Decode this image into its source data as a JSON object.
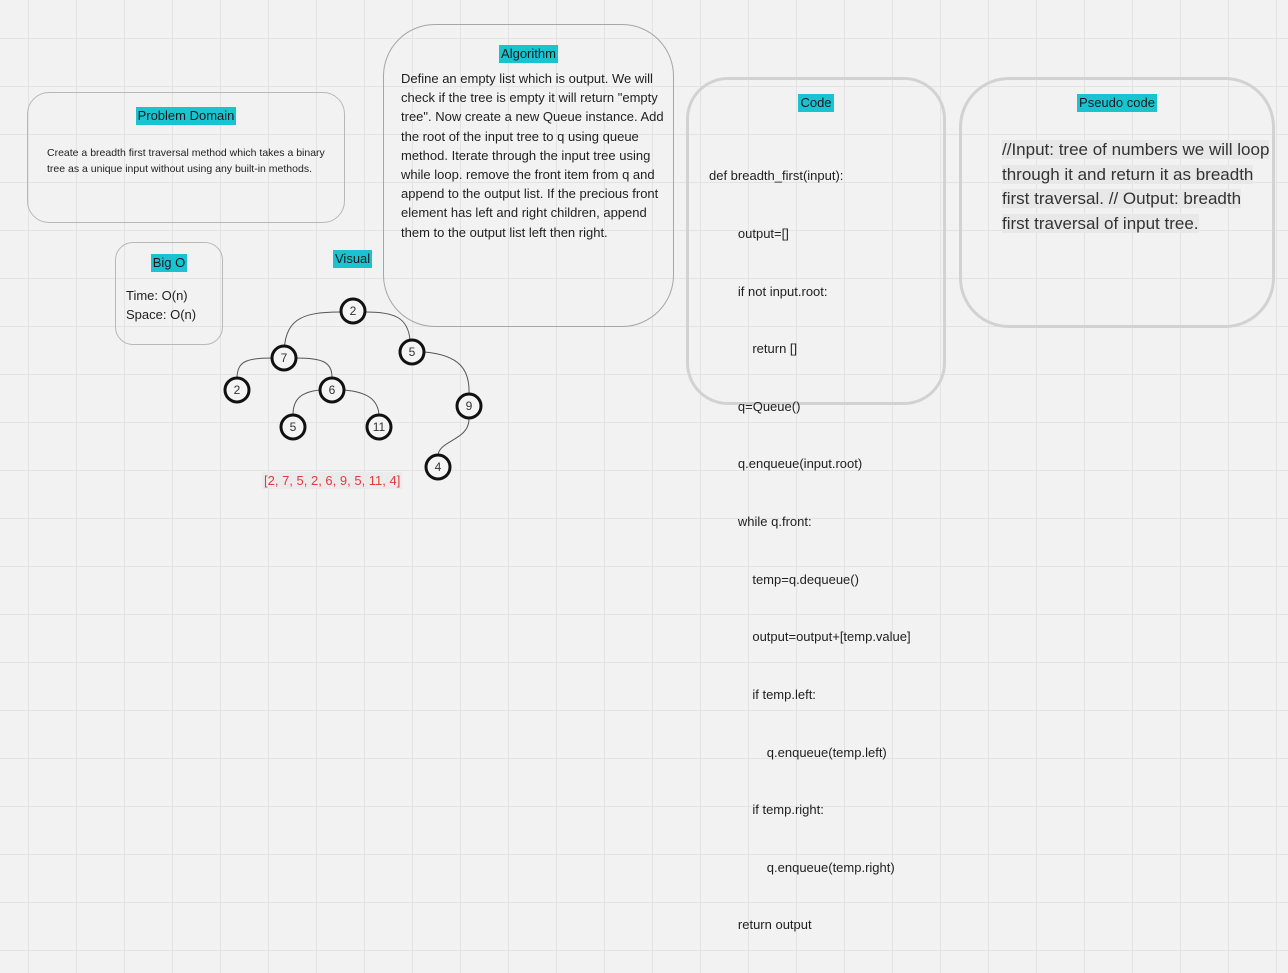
{
  "problem": {
    "title": "Problem Domain",
    "text": "Create a breadth first traversal method which takes a binary tree as a unique input without using any built-in methods."
  },
  "bigo": {
    "title": "Big O",
    "time": "Time: O(n)",
    "space": "Space: O(n)"
  },
  "visual": {
    "title": "Visual",
    "nodes": [
      "2",
      "7",
      "5",
      "2",
      "6",
      "9",
      "5",
      "11",
      "4"
    ],
    "traversal": "[2, 7, 5, 2, 6, 9, 5, 11, 4]"
  },
  "algorithm": {
    "title": "Algorithm",
    "text": "Define an empty list which is output. We will check if the tree is empty it will return \"empty tree\". Now create a new Queue instance. Add the root of the input tree to q using queue method. Iterate through the input tree using while loop. remove the front item from q and append to the output list. If the precious front element has left and right children, append them to the output list left then right."
  },
  "code": {
    "title": "Code",
    "lines": [
      "def breadth_first(input):",
      "        output=[]",
      "        if not input.root:",
      "            return []",
      "        q=Queue()",
      "        q.enqueue(input.root)",
      "        while q.front:",
      "            temp=q.dequeue()",
      "            output=output+[temp.value]",
      "            if temp.left:",
      "                q.enqueue(temp.left)",
      "            if temp.right:",
      "                q.enqueue(temp.right)",
      "        return output"
    ]
  },
  "pseudo": {
    "title": "Pseudo code",
    "text": "//Input: tree of numbers we will loop through it and return it as breadth first traversal. // Output: breadth first traversal of input tree."
  },
  "colors": {
    "highlight": "#19c3cf",
    "traversal": "#e03c3c"
  }
}
